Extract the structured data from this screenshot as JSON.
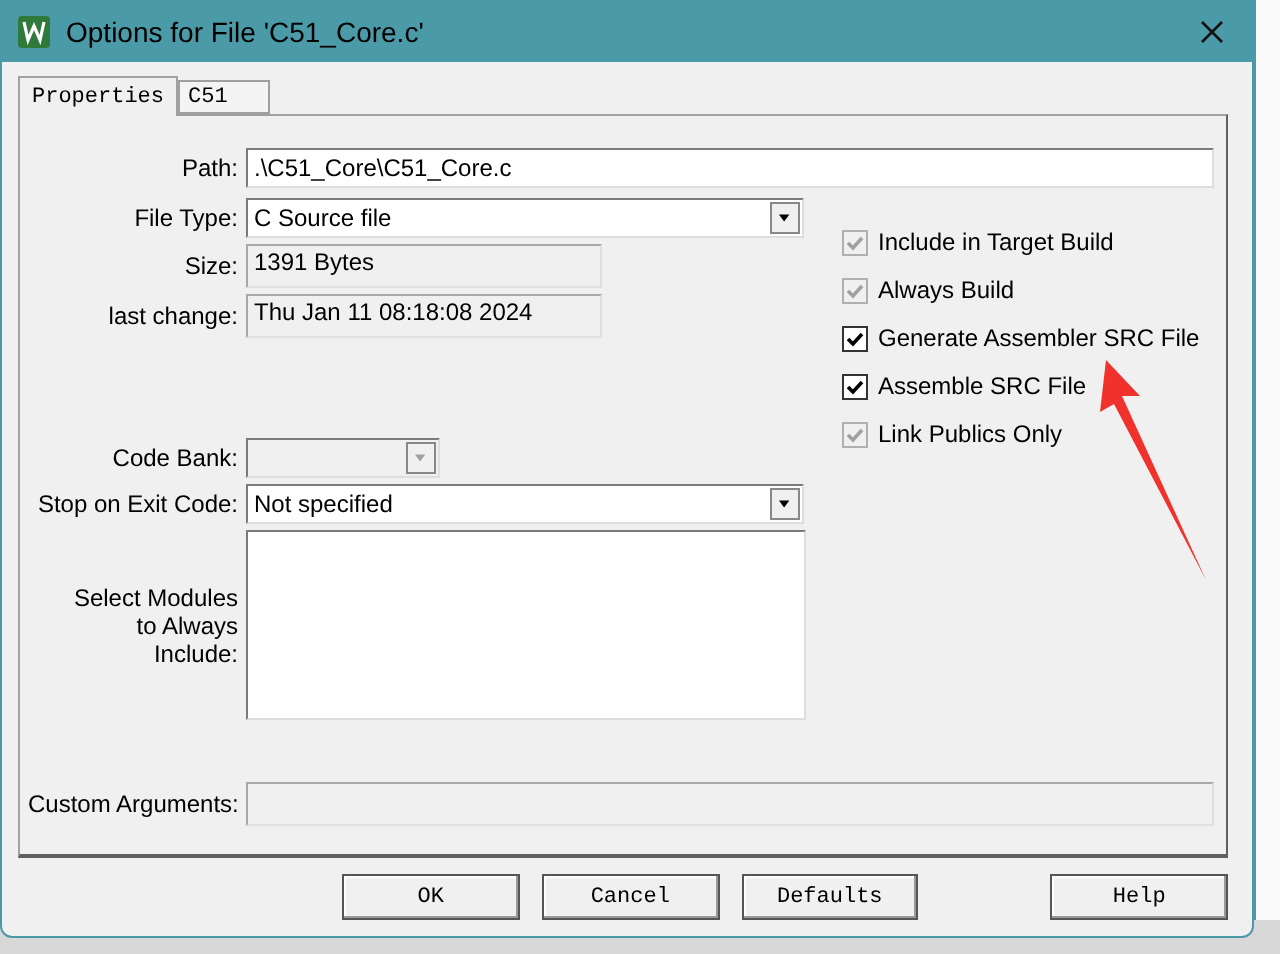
{
  "window": {
    "title": "Options for File 'C51_Core.c'"
  },
  "tabs": [
    {
      "label": "Properties",
      "selected": true
    },
    {
      "label": "C51",
      "selected": false
    }
  ],
  "path": {
    "label": "Path:",
    "value": ".\\C51_Core\\C51_Core.c"
  },
  "fields": [
    {
      "kind": "dropdown",
      "label": "File Type:",
      "value": "C Source file",
      "disabled": false
    },
    {
      "kind": "readonly",
      "label": "Size:",
      "value": "1391 Bytes"
    },
    {
      "kind": "readonly",
      "label": "last change:",
      "value": "Thu Jan 11 08:18:08 2024"
    },
    {
      "kind": "gap"
    },
    {
      "kind": "dropdown",
      "label": "Code Bank:",
      "disabled": true
    },
    {
      "kind": "dropdown",
      "label": "Stop on Exit Code:",
      "value": "Not specified",
      "disabled": false
    },
    {
      "kind": "listbox",
      "label": "Select Modules to Always Include:"
    }
  ],
  "checkboxes": [
    {
      "label": "Include in Target Build",
      "checked": true,
      "disabled": true
    },
    {
      "label": "Always Build",
      "checked": true,
      "disabled": true
    },
    {
      "label": "Generate Assembler SRC File",
      "checked": true,
      "disabled": false
    },
    {
      "label": "Assemble SRC File",
      "checked": true,
      "disabled": false
    },
    {
      "label": "Link Publics Only",
      "checked": true,
      "disabled": true
    }
  ],
  "custom_arguments": {
    "label": "Custom Arguments:"
  },
  "buttons": [
    {
      "label": "OK",
      "kind": "main"
    },
    {
      "label": "Cancel",
      "kind": "main"
    },
    {
      "label": "Defaults",
      "kind": "main"
    },
    {
      "label": "Help",
      "kind": "help"
    }
  ]
}
